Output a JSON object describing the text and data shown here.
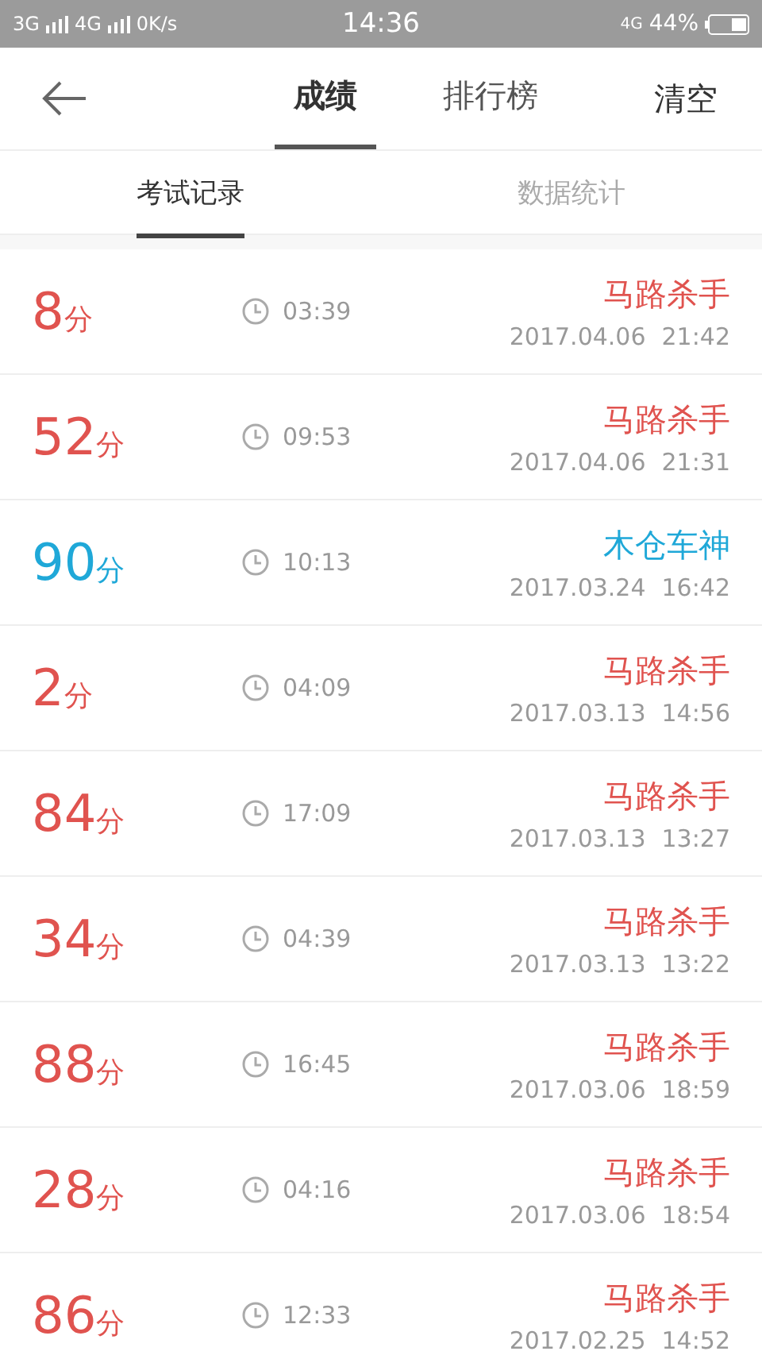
{
  "status_bar": {
    "left": "3G",
    "left2": "4G",
    "speed": "0K/s",
    "time": "14:36",
    "network": "4G",
    "battery": "44%"
  },
  "header": {
    "tabs": [
      {
        "label": "成绩",
        "selected": true
      },
      {
        "label": "排行榜",
        "selected": false
      }
    ],
    "action": "清空"
  },
  "sub_tabs": [
    {
      "label": "考试记录",
      "selected": true
    },
    {
      "label": "数据统计",
      "selected": false
    }
  ],
  "records": [
    {
      "score": "8",
      "unit": "分",
      "duration": "03:39",
      "title": "马路杀手",
      "date": "2017.04.06",
      "time": "21:42",
      "color": "#e0534f"
    },
    {
      "score": "52",
      "unit": "分",
      "duration": "09:53",
      "title": "马路杀手",
      "date": "2017.04.06",
      "time": "21:31",
      "color": "#e0534f"
    },
    {
      "score": "90",
      "unit": "分",
      "duration": "10:13",
      "title": "木仓车神",
      "date": "2017.03.24",
      "time": "16:42",
      "color": "#1fa8d8"
    },
    {
      "score": "2",
      "unit": "分",
      "duration": "04:09",
      "title": "马路杀手",
      "date": "2017.03.13",
      "time": "14:56",
      "color": "#e0534f"
    },
    {
      "score": "84",
      "unit": "分",
      "duration": "17:09",
      "title": "马路杀手",
      "date": "2017.03.13",
      "time": "13:27",
      "color": "#e0534f"
    },
    {
      "score": "34",
      "unit": "分",
      "duration": "04:39",
      "title": "马路杀手",
      "date": "2017.03.13",
      "time": "13:22",
      "color": "#e0534f"
    },
    {
      "score": "88",
      "unit": "分",
      "duration": "16:45",
      "title": "马路杀手",
      "date": "2017.03.06",
      "time": "18:59",
      "color": "#e0534f"
    },
    {
      "score": "28",
      "unit": "分",
      "duration": "04:16",
      "title": "马路杀手",
      "date": "2017.03.06",
      "time": "18:54",
      "color": "#e0534f"
    },
    {
      "score": "86",
      "unit": "分",
      "duration": "12:33",
      "title": "马路杀手",
      "date": "2017.02.25",
      "time": "14:52",
      "color": "#e0534f"
    }
  ]
}
